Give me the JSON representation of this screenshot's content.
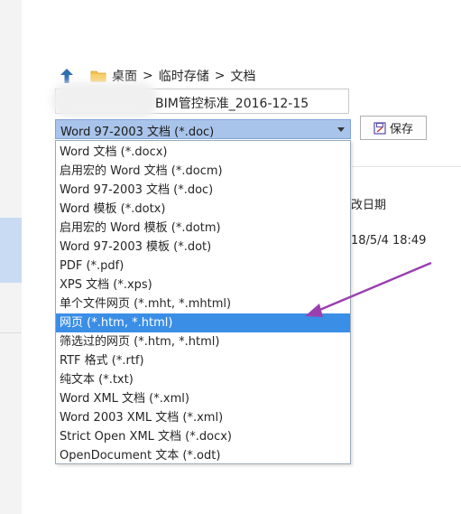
{
  "breadcrumb": {
    "items": [
      "桌面",
      "临时存储",
      "文档"
    ],
    "separator": ">"
  },
  "filename": {
    "value": "BIM管控标准_2016-12-15"
  },
  "file_type": {
    "selected": "Word 97-2003 文档 (*.doc)",
    "options": [
      "Word 文档 (*.docx)",
      "启用宏的 Word 文档 (*.docm)",
      "Word 97-2003 文档 (*.doc)",
      "Word 模板 (*.dotx)",
      "启用宏的 Word 模板 (*.dotm)",
      "Word 97-2003 模板 (*.dot)",
      "PDF (*.pdf)",
      "XPS 文档 (*.xps)",
      "单个文件网页 (*.mht, *.mhtml)",
      "网页 (*.htm, *.html)",
      "筛选过的网页 (*.htm, *.html)",
      "RTF 格式 (*.rtf)",
      "纯文本 (*.txt)",
      "Word XML 文档 (*.xml)",
      "Word 2003 XML 文档 (*.xml)",
      "Strict Open XML 文档 (*.docx)",
      "OpenDocument 文本 (*.odt)"
    ],
    "highlighted": "网页 (*.htm, *.html)"
  },
  "save_button": {
    "label": "保存"
  },
  "file_list": {
    "column_header": "改日期",
    "row_date": "18/5/4 18:49"
  },
  "colors": {
    "highlight": "#3a8ee6",
    "select_bg": "#a9c4ea",
    "annotation_arrow": "#9b3fb0"
  },
  "icons": [
    "up-arrow-icon",
    "folder-icon",
    "save-icon",
    "dropdown-caret-icon",
    "annotation-arrow-icon"
  ]
}
